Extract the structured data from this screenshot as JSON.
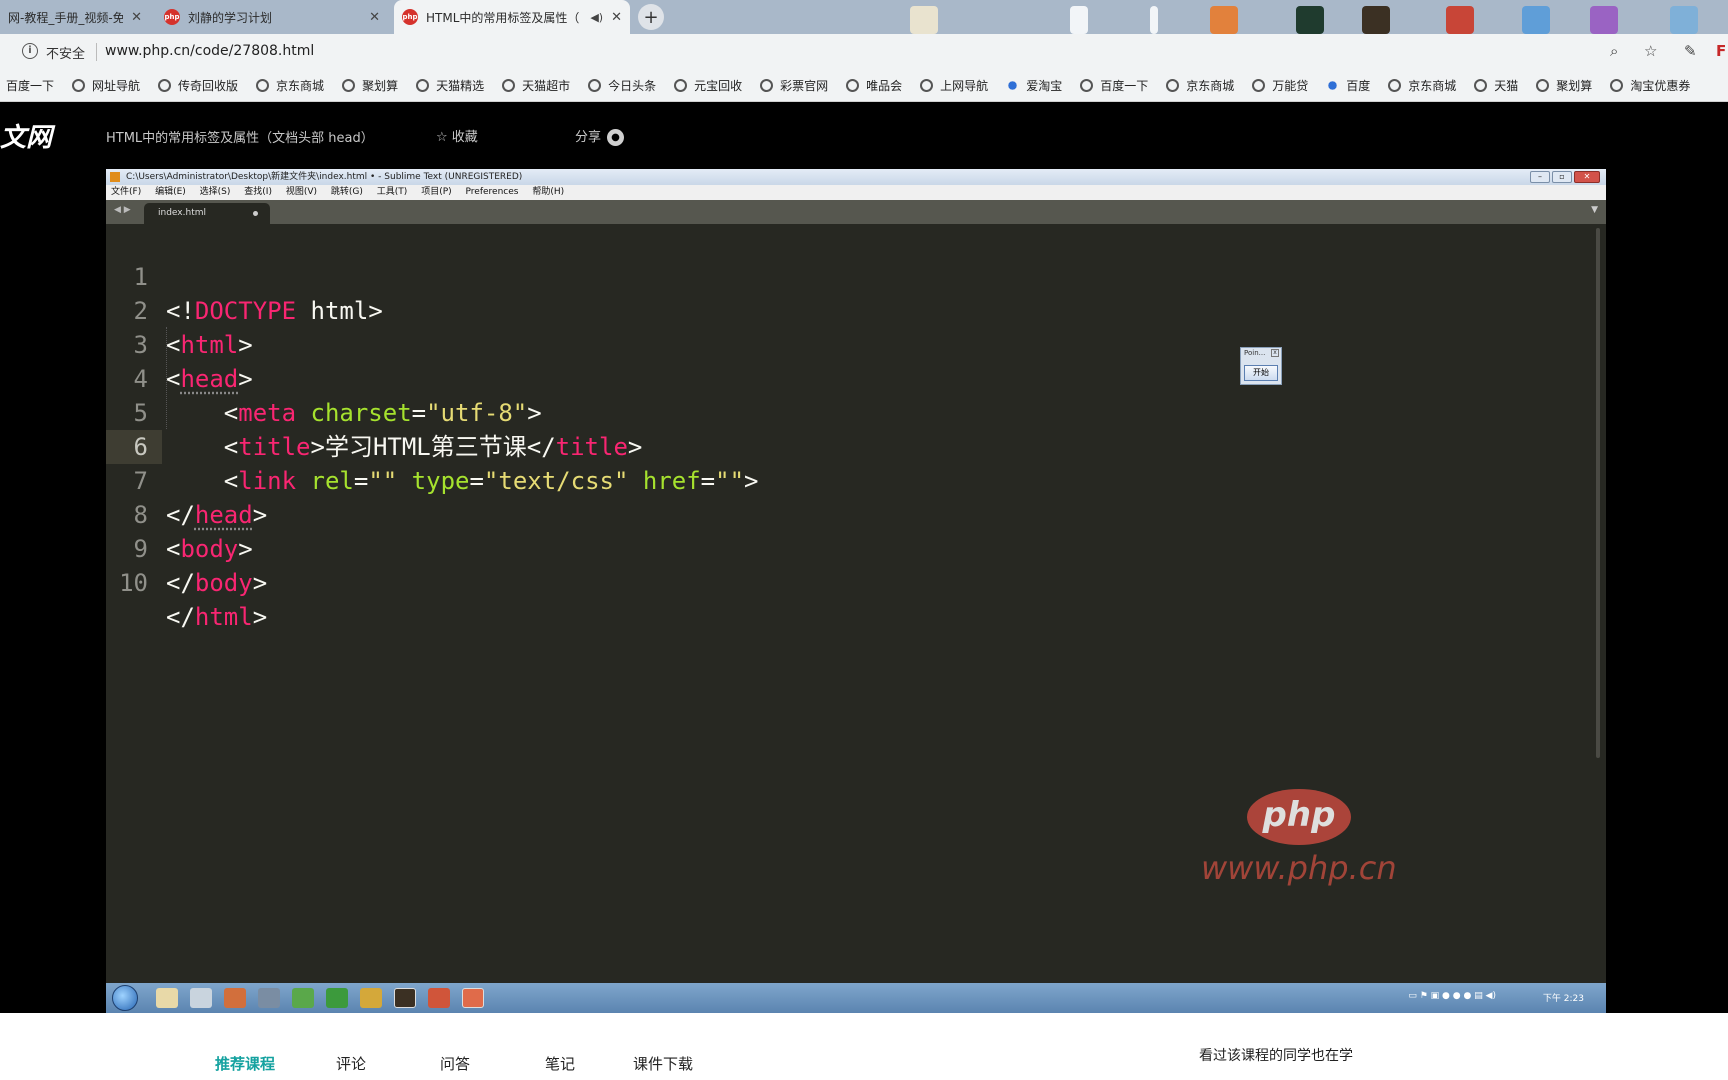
{
  "browser": {
    "tabs": [
      {
        "title": "网-教程_手册_视频-免费",
        "active": false
      },
      {
        "title": "刘静的学习计划",
        "active": false
      },
      {
        "title": "HTML中的常用标签及属性（",
        "active": true
      }
    ],
    "new_tab": "+",
    "address": {
      "security": "不安全",
      "url": "www.php.cn/code/27808.html"
    },
    "bookmarks": [
      "百度一下",
      "网址导航",
      "传奇回收版",
      "京东商城",
      "聚划算",
      "天猫精选",
      "天猫超市",
      "今日头条",
      "元宝回收",
      "彩票官网",
      "唯品会",
      "上网导航",
      "爱淘宝",
      "百度一下",
      "京东商城",
      "万能贷",
      "百度",
      "京东商城",
      "天猫",
      "聚划算",
      "淘宝优惠券"
    ]
  },
  "site": {
    "logo": "文网",
    "course_title": "HTML中的常用标签及属性（文档头部 head）",
    "collect": "收藏",
    "share": "分享"
  },
  "sublime": {
    "title": "C:\\Users\\Administrator\\Desktop\\新建文件夹\\index.html • - Sublime Text (UNREGISTERED)",
    "menu": [
      "文件(F)",
      "编辑(E)",
      "选择(S)",
      "查找(I)",
      "视图(V)",
      "跳转(G)",
      "工具(T)",
      "项目(P)",
      "Preferences",
      "帮助(H)"
    ],
    "file_tab": "index.html",
    "lines": [
      "1",
      "2",
      "3",
      "4",
      "5",
      "6",
      "7",
      "8",
      "9",
      "10"
    ],
    "code": {
      "doctype": "DOCTYPE",
      "doctype_rest": " html",
      "html": "html",
      "head": "head",
      "meta": "meta",
      "charset_attr": "charset",
      "charset_val": "\"utf-8\"",
      "title": "title",
      "title_text": "学习HTML第三节课",
      "link": "link",
      "rel_attr": "rel",
      "rel_val": "\"\"",
      "type_attr": "type",
      "type_val": "\"text/css\"",
      "href_attr": "href",
      "href_val": "\"\"",
      "body": "body"
    },
    "popup": {
      "title": "Poin...",
      "button": "开始"
    },
    "watermark": {
      "logo": "php",
      "url": "www.php.cn"
    },
    "clock": "下午 2:23"
  },
  "page_tabs": [
    "推荐课程",
    "评论",
    "问答",
    "笔记",
    "课件下载"
  ],
  "watching": "看过该课程的同学也在学"
}
